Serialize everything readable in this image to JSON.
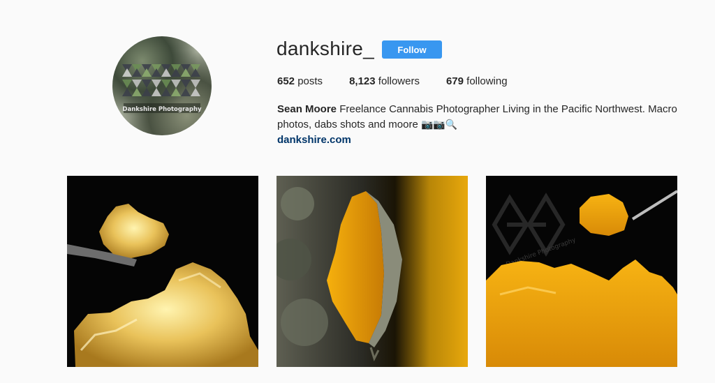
{
  "profile": {
    "username": "dankshire_",
    "follow_label": "Follow",
    "avatar_text": "Dankshire Photography"
  },
  "stats": [
    {
      "count": "652",
      "label": "posts"
    },
    {
      "count": "8,123",
      "label": "followers"
    },
    {
      "count": "679",
      "label": "following"
    }
  ],
  "bio": {
    "name": "Sean Moore",
    "text": "Freelance Cannabis Photographer Living in the Pacific Northwest. Macro photos, dabs shots and moore",
    "emojis": "📷📷🔍",
    "link": "dankshire.com"
  },
  "posts": [
    {
      "description": "amber concentrate on black"
    },
    {
      "description": "cannabis bud with concentrate"
    },
    {
      "description": "golden concentrate with watermark"
    }
  ],
  "watermark": "Dankshire Photography"
}
